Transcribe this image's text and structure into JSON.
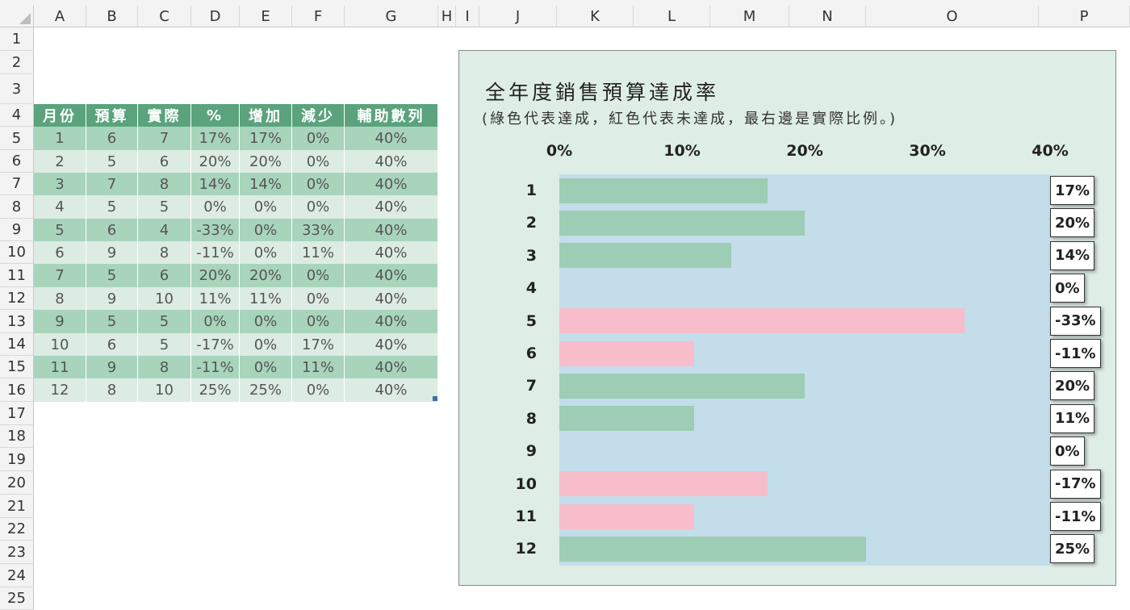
{
  "sheet": {
    "columns": [
      "A",
      "B",
      "C",
      "D",
      "E",
      "F",
      "G",
      "H",
      "I",
      "J",
      "K",
      "L",
      "M",
      "N",
      "O",
      "P"
    ],
    "rows": [
      "1",
      "2",
      "3",
      "4",
      "5",
      "6",
      "7",
      "8",
      "9",
      "10",
      "11",
      "12",
      "13",
      "14",
      "15",
      "16",
      "17",
      "18",
      "19",
      "20",
      "21",
      "22",
      "23",
      "24",
      "25"
    ]
  },
  "table": {
    "headers": [
      "月份",
      "預算",
      "實際",
      "%",
      "增加",
      "減少",
      "輔助數列"
    ],
    "rows": [
      [
        "1",
        "6",
        "7",
        "17%",
        "17%",
        "0%",
        "40%"
      ],
      [
        "2",
        "5",
        "6",
        "20%",
        "20%",
        "0%",
        "40%"
      ],
      [
        "3",
        "7",
        "8",
        "14%",
        "14%",
        "0%",
        "40%"
      ],
      [
        "4",
        "5",
        "5",
        "0%",
        "0%",
        "0%",
        "40%"
      ],
      [
        "5",
        "6",
        "4",
        "-33%",
        "0%",
        "33%",
        "40%"
      ],
      [
        "6",
        "9",
        "8",
        "-11%",
        "0%",
        "11%",
        "40%"
      ],
      [
        "7",
        "5",
        "6",
        "20%",
        "20%",
        "0%",
        "40%"
      ],
      [
        "8",
        "9",
        "10",
        "11%",
        "11%",
        "0%",
        "40%"
      ],
      [
        "9",
        "5",
        "5",
        "0%",
        "0%",
        "0%",
        "40%"
      ],
      [
        "10",
        "6",
        "5",
        "-17%",
        "0%",
        "17%",
        "40%"
      ],
      [
        "11",
        "9",
        "8",
        "-11%",
        "0%",
        "11%",
        "40%"
      ],
      [
        "12",
        "8",
        "10",
        "25%",
        "25%",
        "0%",
        "40%"
      ]
    ]
  },
  "chart_data": {
    "type": "bar",
    "orientation": "horizontal",
    "title": "全年度銷售預算達成率",
    "subtitle": "(綠色代表達成，紅色代表未達成，最右邊是實際比例。)",
    "categories": [
      "1",
      "2",
      "3",
      "4",
      "5",
      "6",
      "7",
      "8",
      "9",
      "10",
      "11",
      "12"
    ],
    "series": [
      {
        "values": [
          17,
          20,
          14,
          0,
          0,
          0,
          20,
          11,
          0,
          0,
          0,
          25
        ],
        "color": "#9dcdb4"
      },
      {
        "values": [
          0,
          0,
          0,
          0,
          33,
          11,
          0,
          0,
          0,
          17,
          11,
          0
        ],
        "color": "#f8bdcb"
      },
      {
        "values": [
          40,
          40,
          40,
          40,
          40,
          40,
          40,
          40,
          40,
          40,
          40,
          40
        ],
        "color": "#c3ddea"
      }
    ],
    "value_labels": [
      "17%",
      "20%",
      "14%",
      "0%",
      "-33%",
      "-11%",
      "20%",
      "11%",
      "0%",
      "-17%",
      "-11%",
      "25%"
    ],
    "xticks": [
      "0%",
      "10%",
      "20%",
      "30%",
      "40%"
    ],
    "xlim": [
      0,
      40
    ],
    "background": "#deede6"
  }
}
